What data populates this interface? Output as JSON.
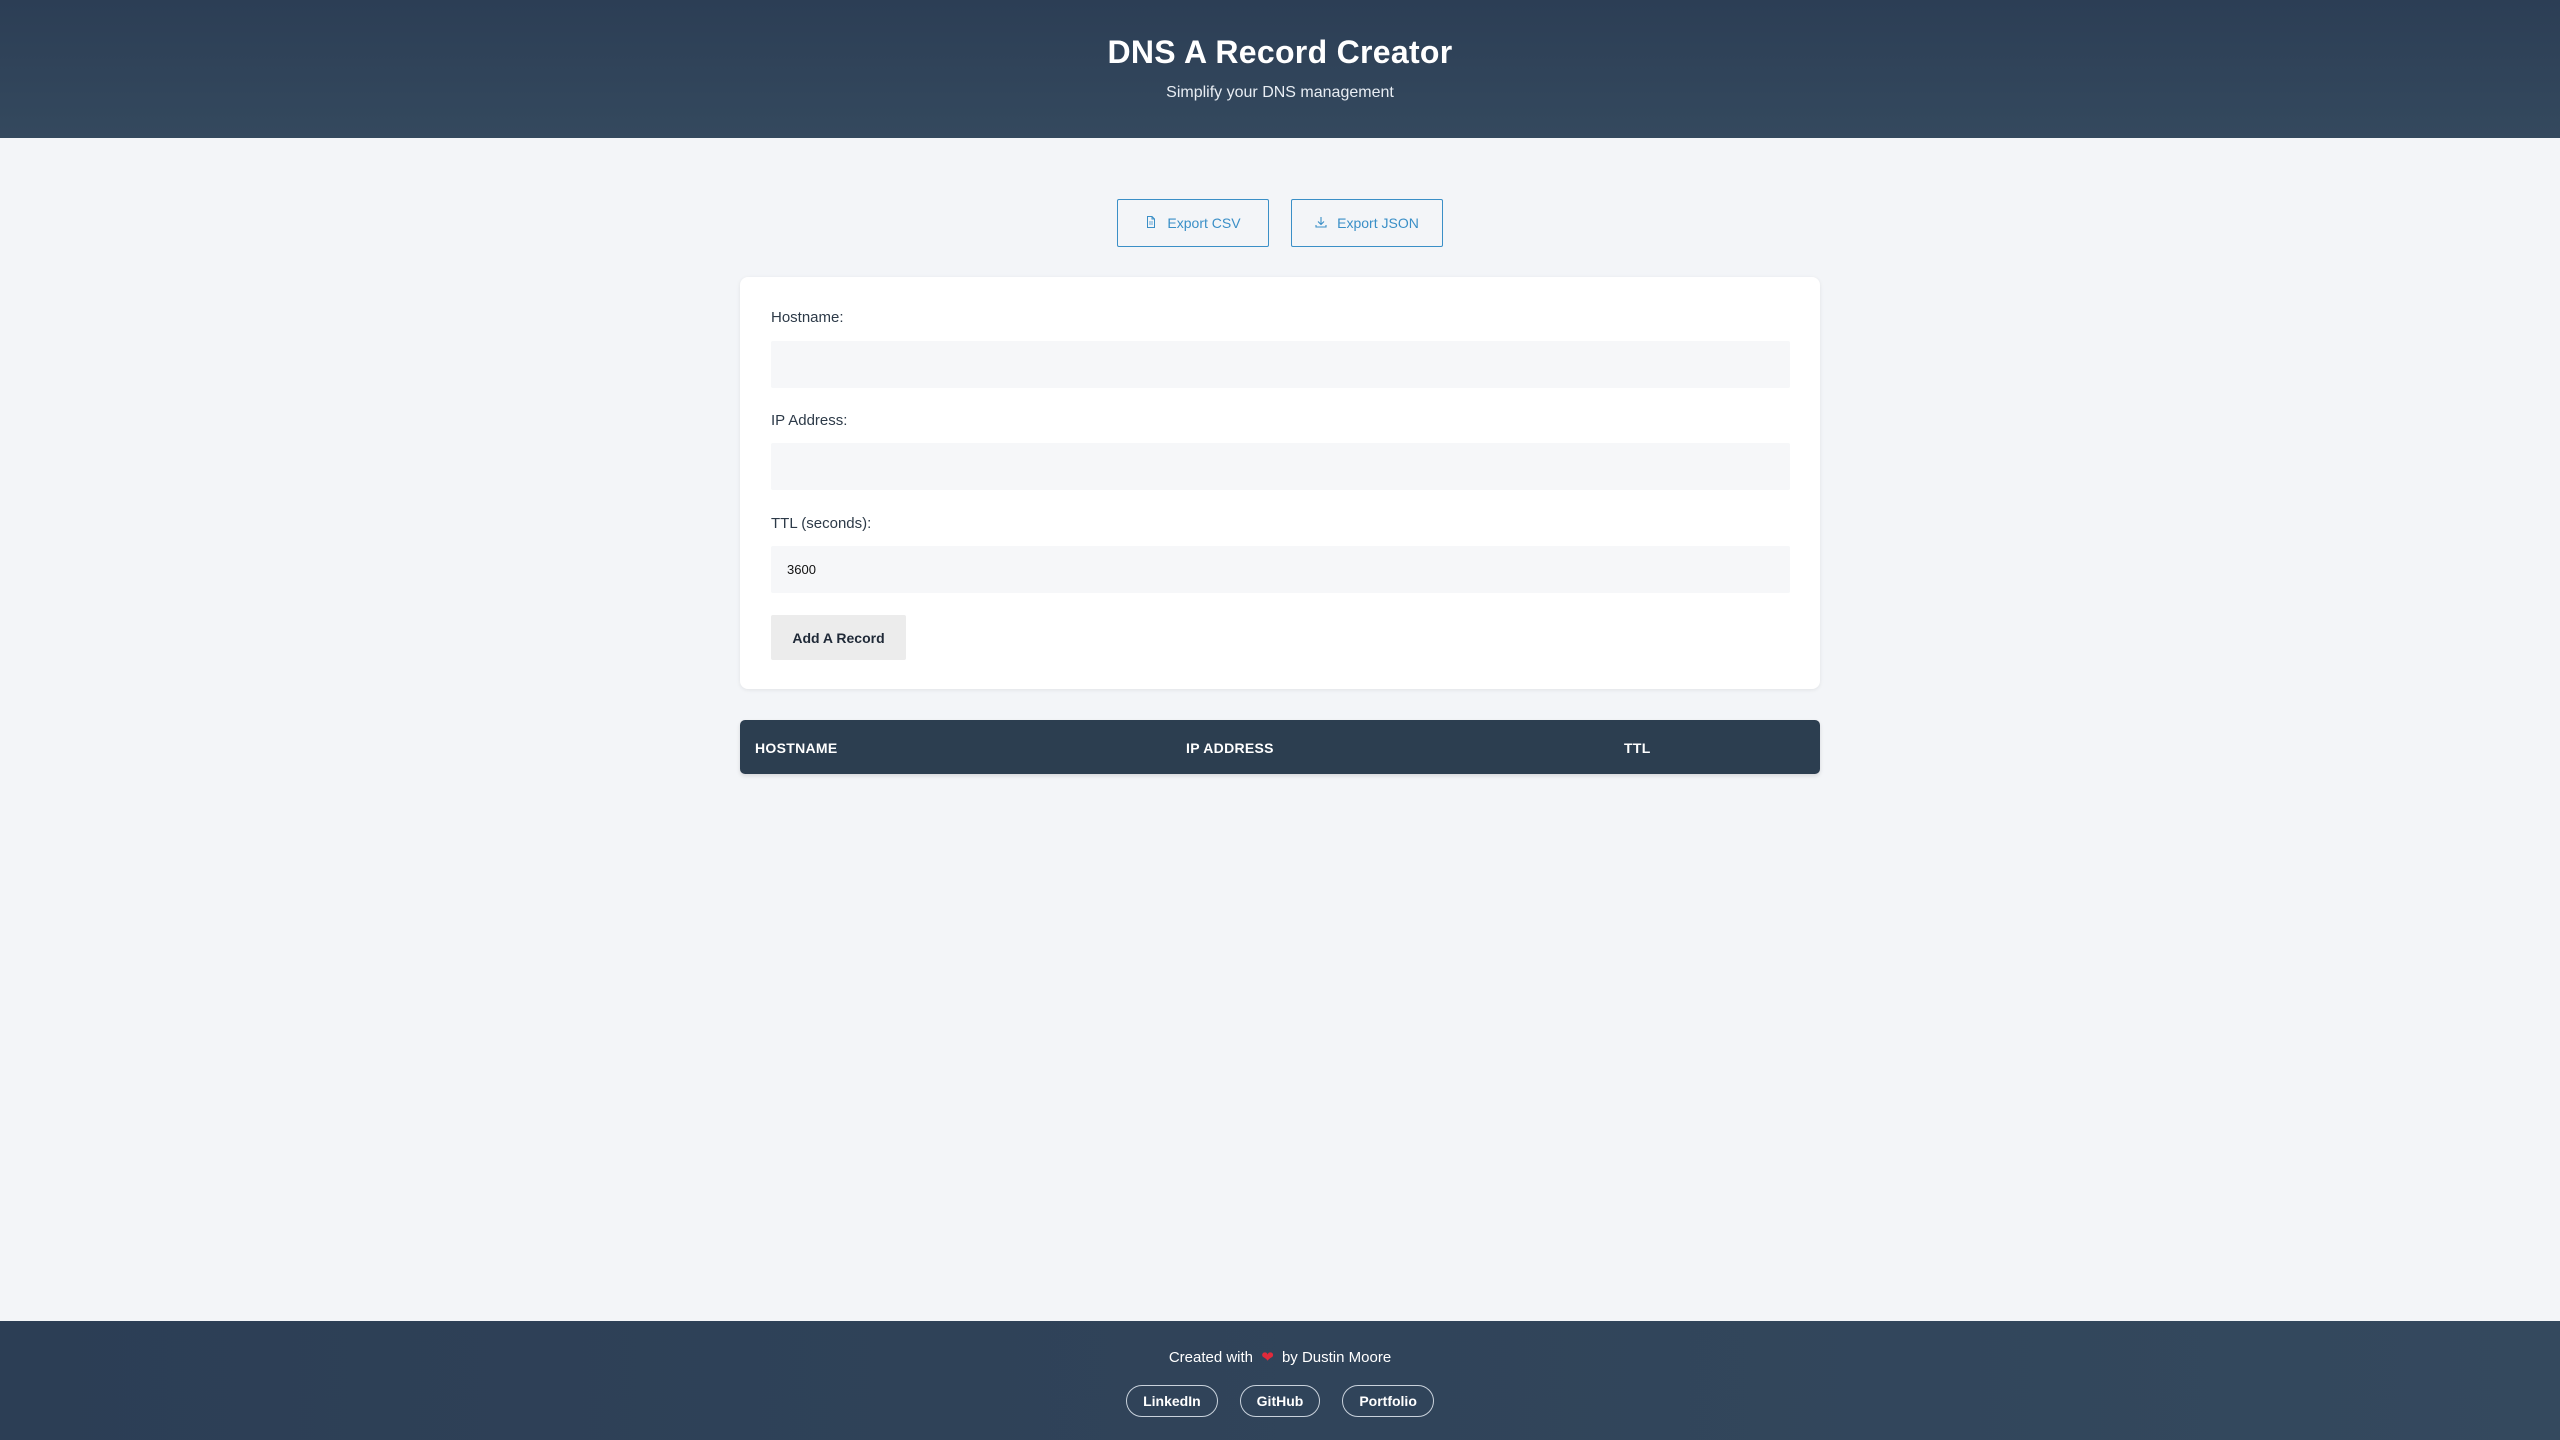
{
  "header": {
    "title": "DNS A Record Creator",
    "subtitle": "Simplify your DNS management"
  },
  "toolbar": {
    "export_csv_label": "Export CSV",
    "export_json_label": "Export JSON"
  },
  "form": {
    "hostname_label": "Hostname:",
    "hostname_value": "",
    "ip_label": "IP Address:",
    "ip_value": "",
    "ttl_label": "TTL (seconds):",
    "ttl_value": "3600",
    "submit_label": "Add A Record"
  },
  "table": {
    "columns": [
      "HOSTNAME",
      "IP ADDRESS",
      "TTL"
    ],
    "rows": []
  },
  "footer": {
    "credit_prefix": "Created with",
    "heart": "❤",
    "credit_suffix": "by Dustin Moore",
    "links": [
      "LinkedIn",
      "GitHub",
      "Portfolio"
    ]
  },
  "colors": {
    "header_bg": "#2c3e55",
    "accent": "#3a8fc7",
    "table_header_bg": "#2c3e50",
    "heart": "#e02a3b"
  },
  "icons": {
    "export_csv": "file-icon",
    "export_json": "download-icon"
  }
}
